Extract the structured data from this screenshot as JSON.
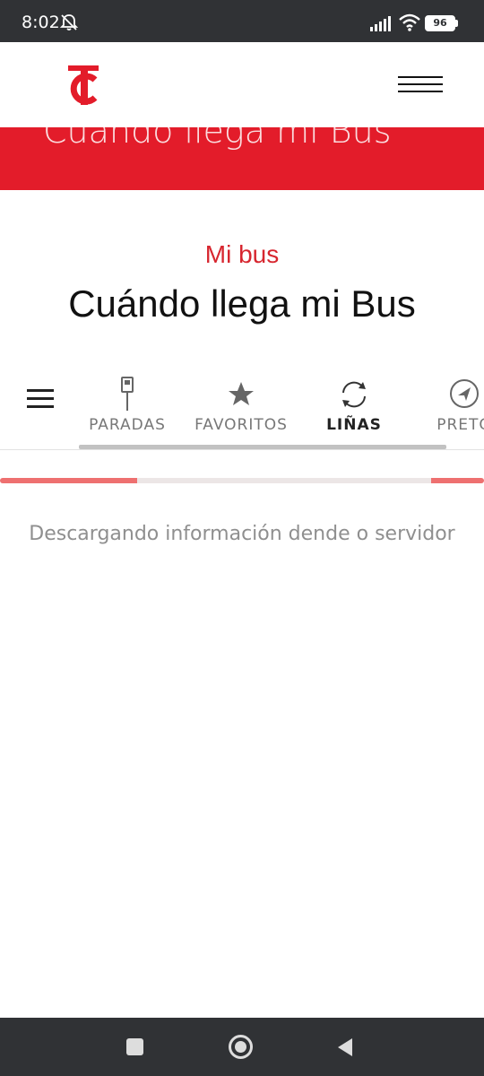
{
  "status_bar": {
    "time": "8:02",
    "battery": "96"
  },
  "banner": {
    "title": "Cuándo llega mi Bus"
  },
  "header": {
    "section_label": "Mi bus",
    "title": "Cuándo llega mi Bus"
  },
  "tabs": [
    {
      "label": "PARADAS",
      "icon": "bus-stop-sign-icon",
      "active": false
    },
    {
      "label": "FAVORITOS",
      "icon": "star-icon",
      "active": false
    },
    {
      "label": "LIÑAS",
      "icon": "refresh-icon",
      "active": true
    },
    {
      "label": "PRETO",
      "icon": "navigation-icon",
      "active": false
    }
  ],
  "loading": {
    "message": "Descargando información dende o servidor",
    "progress_segments": [
      [
        0,
        0.283
      ],
      [
        0.89,
        1
      ]
    ]
  },
  "colors": {
    "brand_red": "#e31c2a",
    "accent_red": "#d7262f",
    "progress": "#ee7070",
    "system_bar": "#303235"
  }
}
